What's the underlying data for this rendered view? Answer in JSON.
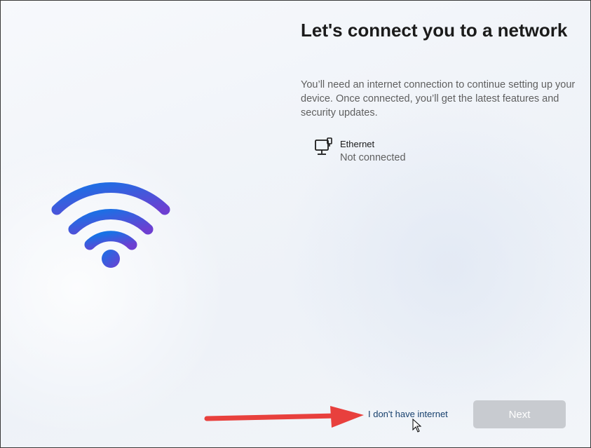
{
  "header": {
    "title": "Let's connect you to a network",
    "description": "You’ll need an internet connection to continue setting up your device. Once connected, you’ll get the latest features and security updates."
  },
  "networks": [
    {
      "name": "Ethernet",
      "status": "Not connected",
      "icon": "ethernet-icon"
    }
  ],
  "footer": {
    "no_internet_label": "I don't have internet",
    "next_label": "Next"
  },
  "illustration": {
    "icon": "wifi-icon",
    "colors": {
      "gradient_start": "#1673e6",
      "gradient_end": "#6d3fd1"
    }
  },
  "annotation": {
    "icon": "red-arrow-icon",
    "color": "#e8403d"
  },
  "colors": {
    "link": "#17406d",
    "button_disabled": "#c8cbd0"
  }
}
